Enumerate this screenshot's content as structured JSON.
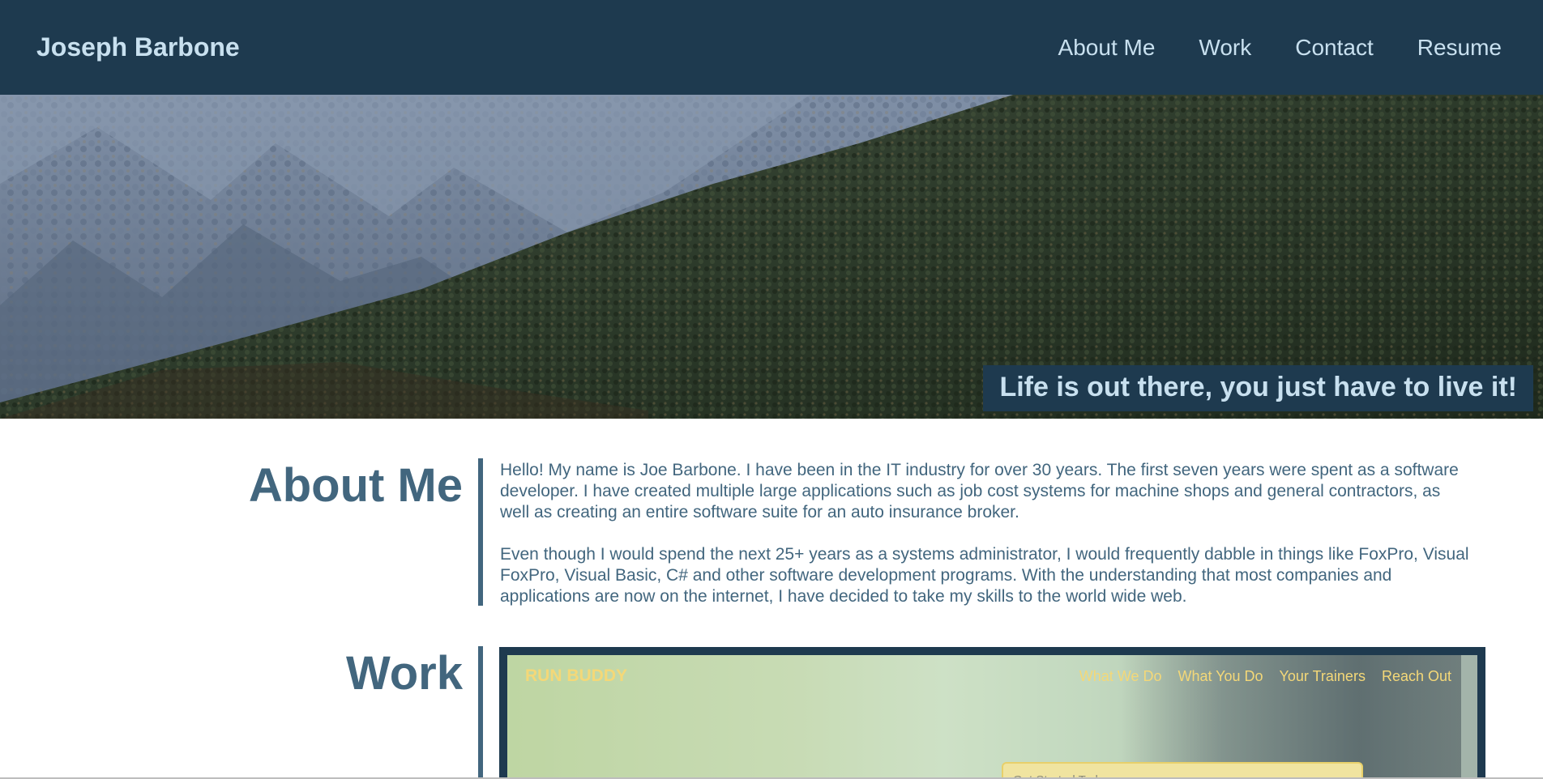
{
  "header": {
    "brand": "Joseph Barbone",
    "nav": [
      "About Me",
      "Work",
      "Contact",
      "Resume"
    ]
  },
  "hero": {
    "caption": "Life is out there, you just have to live it!"
  },
  "about": {
    "title": "About Me",
    "paragraphs": [
      "Hello! My name is Joe Barbone. I have been in the IT industry for over 30 years. The first seven years were spent as a software developer. I have created multiple large applications such as job cost systems for machine shops and general contractors, as well as creating an entire software suite for an auto insurance broker.",
      "Even though I would spend the next 25+ years as a systems administrator, I would frequently dabble in things like FoxPro, Visual FoxPro, Visual Basic, C# and other software development programs. With the understanding that most companies and applications are now on the internet, I have decided to take my skills to the world wide web."
    ]
  },
  "work": {
    "title": "Work",
    "project": {
      "brand": "RUN BUDDY",
      "nav": [
        "What We Do",
        "What You Do",
        "Your Trainers",
        "Reach Out"
      ],
      "card_text": "Get Started Today"
    }
  },
  "colors": {
    "header_bg": "#1e3a4f",
    "header_text": "#c8e0ef",
    "accent": "#42667e",
    "project_yellow": "#f4d878"
  },
  "icons": {
    "hero": "mountain-forest-photo"
  }
}
